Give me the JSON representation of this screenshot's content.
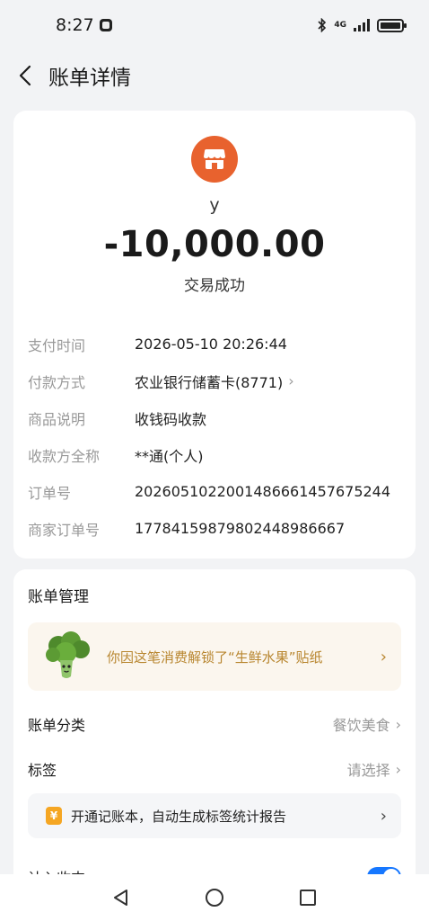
{
  "status_bar": {
    "time": "8:27",
    "network": "4G"
  },
  "nav": {
    "title": "账单详情"
  },
  "transaction": {
    "merchant_name": "y",
    "amount": "-10,000.00",
    "status": "交易成功",
    "details": [
      {
        "label": "支付时间",
        "value": "2026-05-10 20:26:44",
        "has_arrow": false
      },
      {
        "label": "付款方式",
        "value": "农业银行储蓄卡(8771)",
        "has_arrow": true
      },
      {
        "label": "商品说明",
        "value": "收钱码收款",
        "has_arrow": false
      },
      {
        "label": "收款方全称",
        "value": "**通(个人)",
        "has_arrow": false
      },
      {
        "label": "订单号",
        "value": "2026051022001486661457675244",
        "has_arrow": false
      },
      {
        "label": "商家订单号",
        "value": "17784159879802448986667",
        "has_arrow": false
      }
    ]
  },
  "management": {
    "title": "账单管理",
    "sticker_banner": {
      "text": "你因这笔消费解锁了“生鲜水果”贴纸"
    },
    "category": {
      "label": "账单分类",
      "value": "餐饮美食"
    },
    "tag": {
      "label": "标签",
      "value": "请选择"
    },
    "promo": {
      "icon": "¥",
      "text": "开通记账本，自动生成标签统计报告"
    },
    "include_in_stats": {
      "label": "计入收支",
      "enabled": true
    }
  },
  "colors": {
    "merchant_icon": "#e8622e",
    "toggle_on": "#1677ff",
    "sticker_text": "#b8862f",
    "promo_icon": "#f5a623"
  }
}
